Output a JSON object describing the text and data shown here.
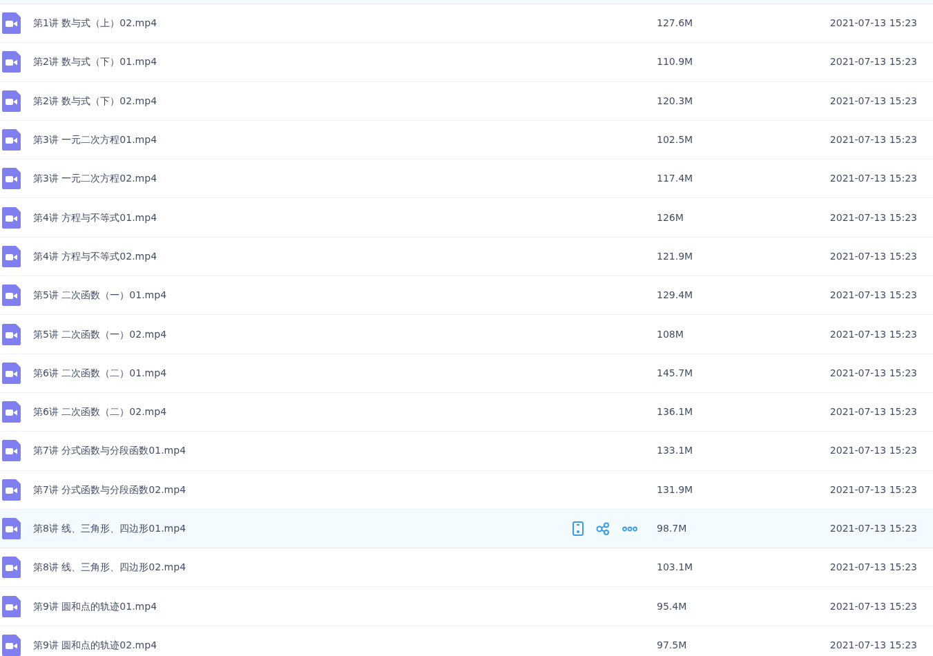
{
  "files": [
    {
      "name": "第1讲 数与式（上）02.mp4",
      "size": "127.6M",
      "modified": "2021-07-13 15:23",
      "hovered": false
    },
    {
      "name": "第2讲 数与式（下）01.mp4",
      "size": "110.9M",
      "modified": "2021-07-13 15:23",
      "hovered": false
    },
    {
      "name": "第2讲 数与式（下）02.mp4",
      "size": "120.3M",
      "modified": "2021-07-13 15:23",
      "hovered": false
    },
    {
      "name": "第3讲 一元二次方程01.mp4",
      "size": "102.5M",
      "modified": "2021-07-13 15:23",
      "hovered": false
    },
    {
      "name": "第3讲 一元二次方程02.mp4",
      "size": "117.4M",
      "modified": "2021-07-13 15:23",
      "hovered": false
    },
    {
      "name": "第4讲 方程与不等式01.mp4",
      "size": "126M",
      "modified": "2021-07-13 15:23",
      "hovered": false
    },
    {
      "name": "第4讲 方程与不等式02.mp4",
      "size": "121.9M",
      "modified": "2021-07-13 15:23",
      "hovered": false
    },
    {
      "name": "第5讲 二次函数（一）01.mp4",
      "size": "129.4M",
      "modified": "2021-07-13 15:23",
      "hovered": false
    },
    {
      "name": "第5讲 二次函数（一）02.mp4",
      "size": "108M",
      "modified": "2021-07-13 15:23",
      "hovered": false
    },
    {
      "name": "第6讲 二次函数（二）01.mp4",
      "size": "145.7M",
      "modified": "2021-07-13 15:23",
      "hovered": false
    },
    {
      "name": "第6讲 二次函数（二）02.mp4",
      "size": "136.1M",
      "modified": "2021-07-13 15:23",
      "hovered": false
    },
    {
      "name": "第7讲 分式函数与分段函数01.mp4",
      "size": "133.1M",
      "modified": "2021-07-13 15:23",
      "hovered": false
    },
    {
      "name": "第7讲 分式函数与分段函数02.mp4",
      "size": "131.9M",
      "modified": "2021-07-13 15:23",
      "hovered": false
    },
    {
      "name": "第8讲 线、三角形、四边形01.mp4",
      "size": "98.7M",
      "modified": "2021-07-13 15:23",
      "hovered": true
    },
    {
      "name": "第8讲 线、三角形、四边形02.mp4",
      "size": "103.1M",
      "modified": "2021-07-13 15:23",
      "hovered": false
    },
    {
      "name": "第9讲 圆和点的轨迹01.mp4",
      "size": "95.4M",
      "modified": "2021-07-13 15:23",
      "hovered": false
    },
    {
      "name": "第9讲 圆和点的轨迹02.mp4",
      "size": "97.5M",
      "modified": "2021-07-13 15:23",
      "hovered": false
    }
  ]
}
